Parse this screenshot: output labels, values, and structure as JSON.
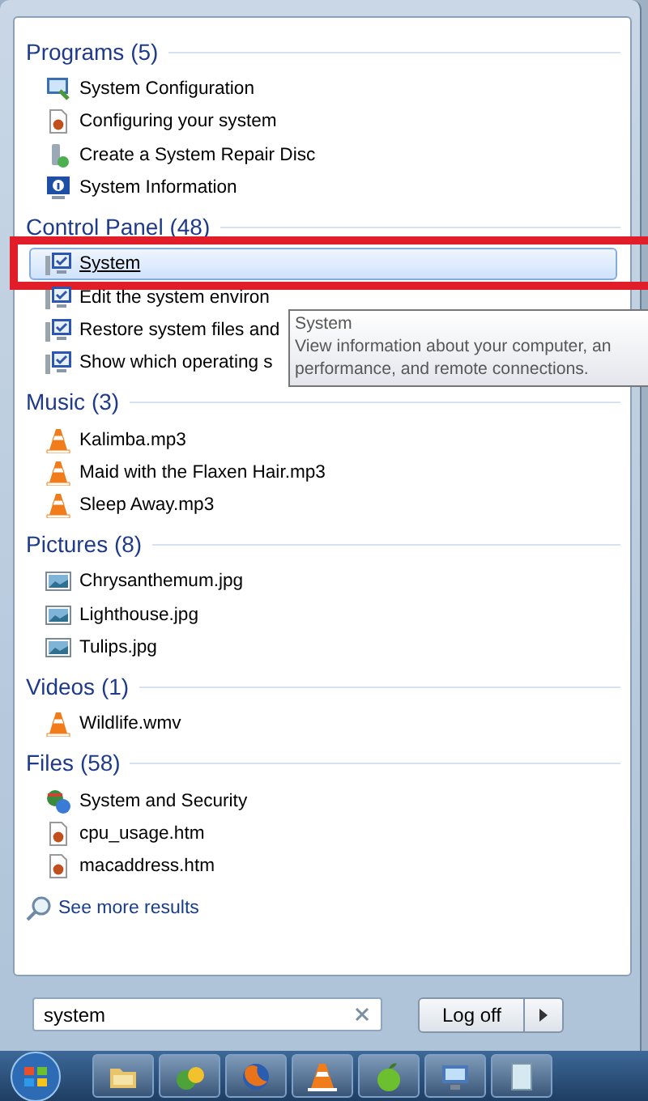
{
  "sections": [
    {
      "title": "Programs (5)",
      "items": [
        {
          "label": "System Configuration",
          "kind": "config",
          "selected": false
        },
        {
          "label": "Configuring your system",
          "kind": "document",
          "selected": false
        },
        {
          "label": "Create a System Repair Disc",
          "kind": "repair",
          "selected": false
        },
        {
          "label": "System Information",
          "kind": "info",
          "selected": false
        }
      ]
    },
    {
      "title": "Control Panel (48)",
      "items": [
        {
          "label": "System",
          "kind": "computer",
          "selected": true
        },
        {
          "label": "Edit the system environ",
          "kind": "computer",
          "selected": false
        },
        {
          "label": "Restore system files and",
          "kind": "computer",
          "selected": false
        },
        {
          "label": "Show which operating s",
          "kind": "computer",
          "selected": false
        }
      ]
    },
    {
      "title": "Music (3)",
      "items": [
        {
          "label": "Kalimba.mp3",
          "kind": "cone",
          "selected": false
        },
        {
          "label": "Maid with the Flaxen Hair.mp3",
          "kind": "cone",
          "selected": false
        },
        {
          "label": "Sleep Away.mp3",
          "kind": "cone",
          "selected": false
        }
      ]
    },
    {
      "title": "Pictures (8)",
      "items": [
        {
          "label": "Chrysanthemum.jpg",
          "kind": "image",
          "selected": false
        },
        {
          "label": "Lighthouse.jpg",
          "kind": "image",
          "selected": false
        },
        {
          "label": "Tulips.jpg",
          "kind": "image",
          "selected": false
        }
      ]
    },
    {
      "title": "Videos (1)",
      "items": [
        {
          "label": "Wildlife.wmv",
          "kind": "cone",
          "selected": false
        }
      ]
    },
    {
      "title": "Files (58)",
      "items": [
        {
          "label": "System and Security",
          "kind": "security",
          "selected": false
        },
        {
          "label": "cpu_usage.htm",
          "kind": "document",
          "selected": false
        },
        {
          "label": "macaddress.htm",
          "kind": "document",
          "selected": false
        }
      ]
    }
  ],
  "tooltip": {
    "title": "System",
    "lines": [
      "View information about your computer, an",
      "performance, and remote connections."
    ]
  },
  "see_more": "See more results",
  "search": {
    "value": "system"
  },
  "log_off": "Log off",
  "taskbar": [
    {
      "kind": "folder"
    },
    {
      "kind": "media"
    },
    {
      "kind": "browser"
    },
    {
      "kind": "cone"
    },
    {
      "kind": "apple"
    },
    {
      "kind": "monitor"
    },
    {
      "kind": "notepad"
    }
  ]
}
